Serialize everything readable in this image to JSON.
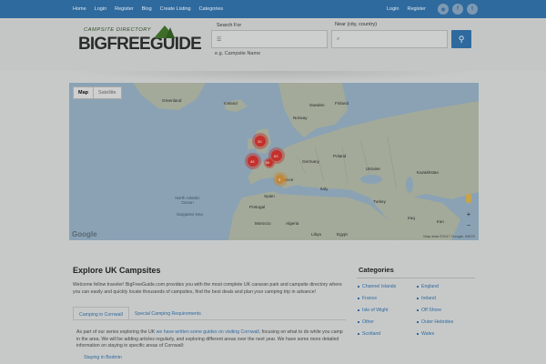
{
  "nav": {
    "left": [
      "Home",
      "Login",
      "Register",
      "Blog",
      "Create Listing",
      "Categories"
    ],
    "right": [
      "Login",
      "Register"
    ]
  },
  "logo": {
    "small": "CAMPSITE DIRECTORY",
    "big": "BIGFREEGUIDE"
  },
  "search": {
    "for_label": "Search For",
    "near_label": "Near (city, country)",
    "example": "e.g. Campsite Name"
  },
  "map": {
    "tab_map": "Map",
    "tab_satellite": "Satellite",
    "google": "Google",
    "footer": "Map data ©2017 Google, INEGI",
    "zoom_in": "+",
    "zoom_out": "−",
    "labels": {
      "greenland": "Greenland",
      "iceland": "Iceland",
      "sweden": "Sweden",
      "finland": "Finland",
      "norway": "Norway",
      "ukraine": "Ukraine",
      "poland": "Poland",
      "germany": "Germany",
      "france": "France",
      "spain": "Spain",
      "portugal": "Portugal",
      "italy": "Italy",
      "turkey": "Turkey",
      "kazakhstan": "Kazakhstan",
      "algeria": "Algeria",
      "libya": "Libya",
      "egypt": "Egypt",
      "morocco": "Morocco",
      "iraq": "Iraq",
      "iran": "Iran",
      "north_atlantic": "North Atlantic Ocean",
      "sargasso": "Sargasso Sea"
    },
    "clusters": [
      "20",
      "63",
      "43",
      "68",
      "9"
    ]
  },
  "content": {
    "title": "Explore UK Campsites",
    "intro": "Welcome fellow traveler! BigFreeGuide.com provides you with the most complete UK caravan park and campsite directory where you can easily and quickly locate thousands of campsites, find the best deals and plan your camping trip in advance!",
    "tabs": [
      "Camping in Cornwall",
      "Special Camping Requirements"
    ],
    "para_a": "As part of our series exploring the UK ",
    "para_link": "we have written some guides on visiting Cornwall",
    "para_b": ", focusing on what to do while you camp in the area. We will be adding articles regularly, and exploring different areas over the next year. We have some more detailed information on staying in specific areas of Cornwall:",
    "list_item": "Staying in Bodmin"
  },
  "sidebar": {
    "title": "Categories",
    "items": [
      "Channel Islands",
      "England",
      "France",
      "Ireland",
      "Isle of Wight",
      "Off Shore",
      "Other",
      "Outer Hebrides",
      "Scotland",
      "Wales"
    ]
  }
}
